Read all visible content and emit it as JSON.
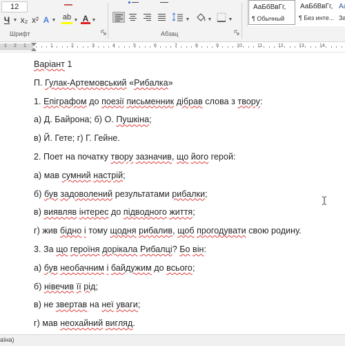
{
  "ribbon": {
    "font_size": "12",
    "buttons": {
      "underline": "Ч",
      "subscript": "x₂",
      "superscript": "x²",
      "text_effects": "A",
      "highlight": "ab",
      "font_color": "A"
    },
    "groups": {
      "font_label": "Шрифт",
      "paragraph_label": "Абзац"
    },
    "styles": [
      {
        "sample": "АаБбВвГг,",
        "name": "¶ Обычный"
      },
      {
        "sample": "АаБбВвГг,",
        "name": "¶ Без инте..."
      },
      {
        "sample": "АаБбВв",
        "name": "Заг"
      }
    ],
    "colors": {
      "highlight": "#ffff00",
      "font_color": "#e02020",
      "text_effect": "#4a7fd4"
    }
  },
  "ruler": {
    "left_numbers": [
      "1",
      "2",
      "1"
    ],
    "numbers": [
      "1",
      "2",
      "3",
      "4",
      "5",
      "6",
      "7",
      "8",
      "9",
      "10",
      "11",
      "12",
      "13",
      "14"
    ]
  },
  "document": {
    "lines": [
      [
        {
          "t": "Варіант",
          "s": 1
        },
        {
          "t": " 1"
        }
      ],
      [
        {
          "t": "П. "
        },
        {
          "t": "Гулак-Артемовський",
          "s": 1
        },
        {
          "t": " «"
        },
        {
          "t": "Рибалка",
          "s": 1
        },
        {
          "t": "»"
        }
      ],
      [
        {
          "t": "1. "
        },
        {
          "t": "Епіграфом",
          "s": 1
        },
        {
          "t": " до "
        },
        {
          "t": "поезії",
          "s": 1
        },
        {
          "t": " "
        },
        {
          "t": "письменник",
          "s": 1
        },
        {
          "t": " "
        },
        {
          "t": "дібрав",
          "s": 1
        },
        {
          "t": " слова з "
        },
        {
          "t": "твору",
          "s": 1
        },
        {
          "t": ":"
        }
      ],
      [
        {
          "t": "а) Д. Байрона; б) О. "
        },
        {
          "t": "Пушкіна",
          "s": 1
        },
        {
          "t": ";"
        }
      ],
      [
        {
          "t": "в) Й. Гете; г) Г. Гейне."
        }
      ],
      [
        {
          "t": "2. Поет на початку "
        },
        {
          "t": "твору",
          "s": 1
        },
        {
          "t": " "
        },
        {
          "t": "зазначив",
          "s": 1
        },
        {
          "t": ", "
        },
        {
          "t": "що",
          "s": 1
        },
        {
          "t": " "
        },
        {
          "t": "його",
          "s": 1
        },
        {
          "t": " герой:"
        }
      ],
      [
        {
          "t": "а) мав "
        },
        {
          "t": "сумний",
          "s": 1
        },
        {
          "t": " "
        },
        {
          "t": "настрій",
          "s": 1
        },
        {
          "t": ";"
        }
      ],
      [
        {
          "t": "б) "
        },
        {
          "t": "був",
          "s": 1
        },
        {
          "t": " "
        },
        {
          "t": "задоволений",
          "s": 1
        },
        {
          "t": " результатами "
        },
        {
          "t": "рибалки",
          "s": 1
        },
        {
          "t": ";"
        }
      ],
      [
        {
          "t": "в) "
        },
        {
          "t": "виявляв",
          "s": 1
        },
        {
          "t": " "
        },
        {
          "t": "інтерес",
          "s": 1
        },
        {
          "t": " до "
        },
        {
          "t": "підводного",
          "s": 1
        },
        {
          "t": " "
        },
        {
          "t": "життя",
          "s": 1
        },
        {
          "t": ";"
        }
      ],
      [
        {
          "t": "г) жив "
        },
        {
          "t": "бідно",
          "s": 1
        },
        {
          "t": " "
        },
        {
          "t": "і",
          "s": 1
        },
        {
          "t": " тому "
        },
        {
          "t": "щодня",
          "s": 1
        },
        {
          "t": " "
        },
        {
          "t": "рибалив",
          "s": 1
        },
        {
          "t": ", "
        },
        {
          "t": "щоб",
          "s": 1
        },
        {
          "t": " "
        },
        {
          "t": "прогодувати",
          "s": 1
        },
        {
          "t": " свою родину."
        }
      ],
      [
        {
          "t": "3. За "
        },
        {
          "t": "що",
          "s": 1
        },
        {
          "t": " "
        },
        {
          "t": "героїня",
          "s": 1
        },
        {
          "t": " "
        },
        {
          "t": "дорікала",
          "s": 1
        },
        {
          "t": " "
        },
        {
          "t": "Рибалці",
          "s": 1
        },
        {
          "t": "? "
        },
        {
          "t": "Бо",
          "s": 1
        },
        {
          "t": " "
        },
        {
          "t": "він",
          "s": 1
        },
        {
          "t": ":"
        }
      ],
      [
        {
          "t": "а) "
        },
        {
          "t": "був",
          "s": 1
        },
        {
          "t": " "
        },
        {
          "t": "необачним",
          "s": 1
        },
        {
          "t": " "
        },
        {
          "t": "і",
          "s": 1
        },
        {
          "t": " "
        },
        {
          "t": "байдужим",
          "s": 1
        },
        {
          "t": " до "
        },
        {
          "t": "всього",
          "s": 1
        },
        {
          "t": ";"
        }
      ],
      [
        {
          "t": "б) "
        },
        {
          "t": "нівечив",
          "s": 1
        },
        {
          "t": " "
        },
        {
          "t": "її",
          "s": 1
        },
        {
          "t": " "
        },
        {
          "t": "рід",
          "s": 1
        },
        {
          "t": ";"
        }
      ],
      [
        {
          "t": "в) не "
        },
        {
          "t": "звертав",
          "s": 1
        },
        {
          "t": " на "
        },
        {
          "t": "неї",
          "s": 1
        },
        {
          "t": " "
        },
        {
          "t": "уваги",
          "s": 1
        },
        {
          "t": ";"
        }
      ],
      [
        {
          "t": "г) мав "
        },
        {
          "t": "неохайний",
          "s": 1
        },
        {
          "t": " "
        },
        {
          "t": "вигляд",
          "s": 1
        },
        {
          "t": "."
        }
      ]
    ],
    "spellcheck_color": "#e03a3a"
  },
  "status_bar": {
    "text": "аїна)"
  }
}
